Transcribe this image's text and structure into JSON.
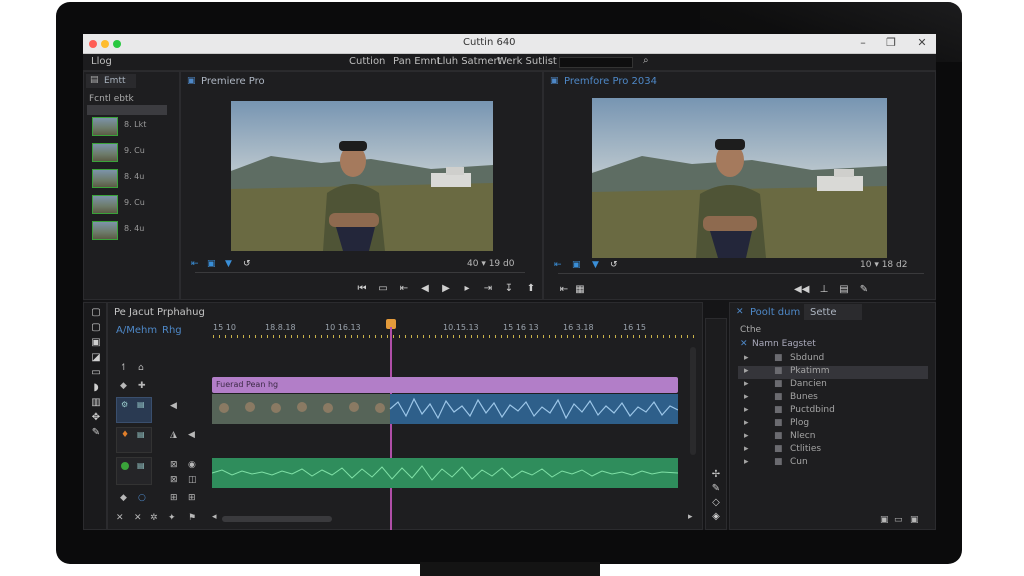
{
  "window": {
    "title": "Cuttin 640"
  },
  "menubar": {
    "left_item": "Llog",
    "items": [
      "Cuttion",
      "Pan Emnt",
      "Lluh Satmert",
      "Werk Sutlist"
    ]
  },
  "project_panel": {
    "tab": "Emtt",
    "folder_label": "Fcntl ebtk",
    "clips": [
      {
        "label": "8. Lkt"
      },
      {
        "label": "9. Cu"
      },
      {
        "label": "8. 4u"
      },
      {
        "label": "9. Cu"
      },
      {
        "label": "8. 4u"
      }
    ]
  },
  "source_monitor": {
    "title": "Premiere Pro",
    "right_readout": "40 ▾ 19 d0"
  },
  "program_monitor": {
    "title": "Premfore Pro 2034",
    "right_readout": "10 ▾ 18 d2"
  },
  "timeline": {
    "title": "Pe Jacut Prphahug",
    "sequence_label": "A/Mehm",
    "sequence_label2": "Rhg",
    "ruler_marks": [
      "15 10",
      "18.8.18",
      "10 16.13",
      "10.15.13",
      "15 16 13",
      "16 3.18",
      "16 15"
    ],
    "video_clip_label": "Fuerad Pean hg"
  },
  "effects_panel": {
    "tab1": "Poolt dum",
    "tab2": "Sette",
    "search_label": "Cthe",
    "subheader": "Namn Eagstet",
    "items": [
      {
        "label": "Sbdund"
      },
      {
        "label": "Pkatimm"
      },
      {
        "label": "Dancien"
      },
      {
        "label": "Bunes"
      },
      {
        "label": "Puctdbind"
      },
      {
        "label": "Plog"
      },
      {
        "label": "Nlecn"
      },
      {
        "label": "Ctlities"
      },
      {
        "label": "Cun"
      }
    ]
  },
  "colors": {
    "accent_blue": "#3a8fd8",
    "playhead": "#b04fa8",
    "video_clip_header": "#b27ec8",
    "video_clip": "#2e5f8a",
    "audio_clip": "#2f8d5c",
    "active_clip_border": "#3aa33a"
  }
}
